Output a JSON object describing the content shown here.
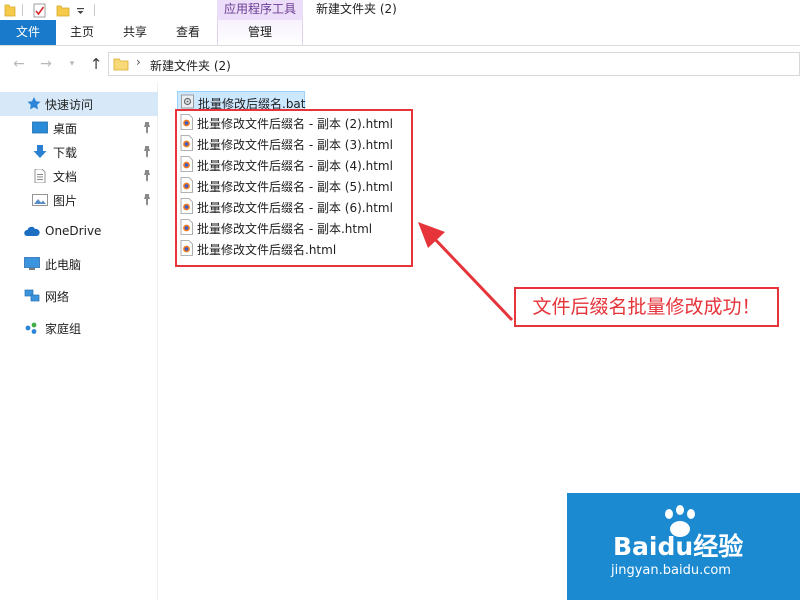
{
  "window": {
    "contextual_tab_title": "应用程序工具",
    "title": "新建文件夹 (2)"
  },
  "ribbon": {
    "tabs": [
      {
        "label": "文件",
        "active": true
      },
      {
        "label": "主页"
      },
      {
        "label": "共享"
      },
      {
        "label": "查看"
      },
      {
        "label": "管理"
      }
    ]
  },
  "address": {
    "path": "新建文件夹 (2)"
  },
  "nav_pane": {
    "quick_access": "快速访问",
    "pinned": [
      {
        "label": "桌面",
        "icon": "desktop-icon"
      },
      {
        "label": "下载",
        "icon": "download-icon"
      },
      {
        "label": "文档",
        "icon": "document-icon"
      },
      {
        "label": "图片",
        "icon": "picture-icon"
      }
    ],
    "onedrive": "OneDrive",
    "this_pc": "此电脑",
    "network": "网络",
    "homegroup": "家庭组"
  },
  "files": [
    {
      "name": "批量修改后缀名.bat",
      "icon": "bat-file-icon",
      "selected": true
    },
    {
      "name": "批量修改文件后缀名 - 副本 (2).html",
      "icon": "html-file-icon"
    },
    {
      "name": "批量修改文件后缀名 - 副本 (3).html",
      "icon": "html-file-icon"
    },
    {
      "name": "批量修改文件后缀名 - 副本 (4).html",
      "icon": "html-file-icon"
    },
    {
      "name": "批量修改文件后缀名 - 副本 (5).html",
      "icon": "html-file-icon"
    },
    {
      "name": "批量修改文件后缀名 - 副本 (6).html",
      "icon": "html-file-icon"
    },
    {
      "name": "批量修改文件后缀名 - 副本.html",
      "icon": "html-file-icon"
    },
    {
      "name": "批量修改文件后缀名.html",
      "icon": "html-file-icon"
    }
  ],
  "annotation": {
    "callout": "文件后缀名批量修改成功！",
    "color": "#e5343a"
  },
  "watermark": {
    "logo": "Baidu经验",
    "url": "jingyan.baidu.com"
  },
  "colors": {
    "accent": "#1979ca",
    "selection": "#cce8ff",
    "contextual": "#ecdef8"
  }
}
